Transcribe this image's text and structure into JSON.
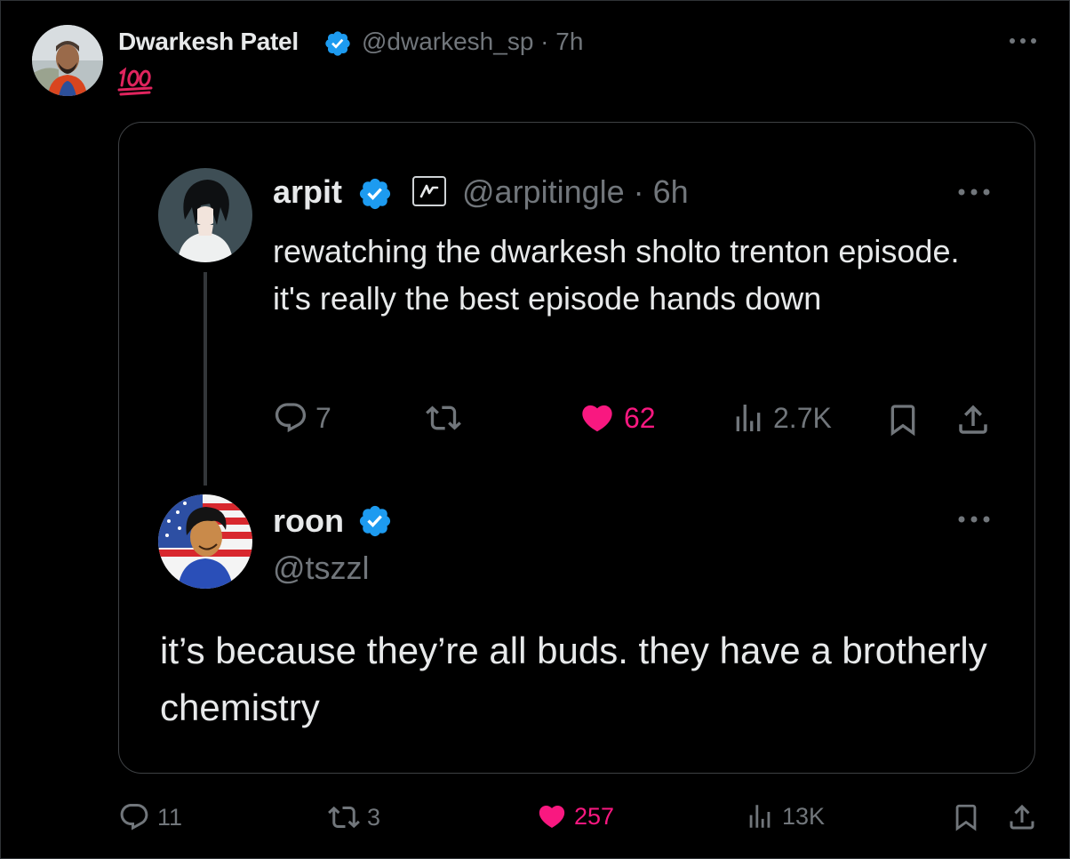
{
  "outer": {
    "name": "Dwarkesh Patel",
    "handle_time": "@dwarkesh_sp · 7h",
    "body_emoji": "100-emoji",
    "actions": {
      "replies": "11",
      "reposts": "3",
      "likes": "257",
      "views": "13K"
    }
  },
  "quoted": {
    "author": {
      "name": "arpit",
      "handle_time": "@arpitingle · 6h",
      "text": "rewatching the dwarkesh sholto trenton episode. it's really the best episode hands down",
      "actions": {
        "replies": "7",
        "reposts": "",
        "likes": "62",
        "views": "2.7K"
      }
    },
    "reply": {
      "name": "roon",
      "handle": "@tszzl",
      "text": "it’s because they’re all buds. they have a brotherly chemistry"
    }
  },
  "colors": {
    "background": "#000000",
    "text_primary": "#e7e9ea",
    "text_secondary": "#71767b",
    "verified_blue": "#1d9bf0",
    "like_pink": "#f91880",
    "border": "#2f3336"
  },
  "icons": [
    "verified-badge-icon",
    "more-icon",
    "reply-icon",
    "repost-icon",
    "like-icon",
    "views-icon",
    "bookmark-icon",
    "share-icon",
    "affiliate-icon"
  ]
}
